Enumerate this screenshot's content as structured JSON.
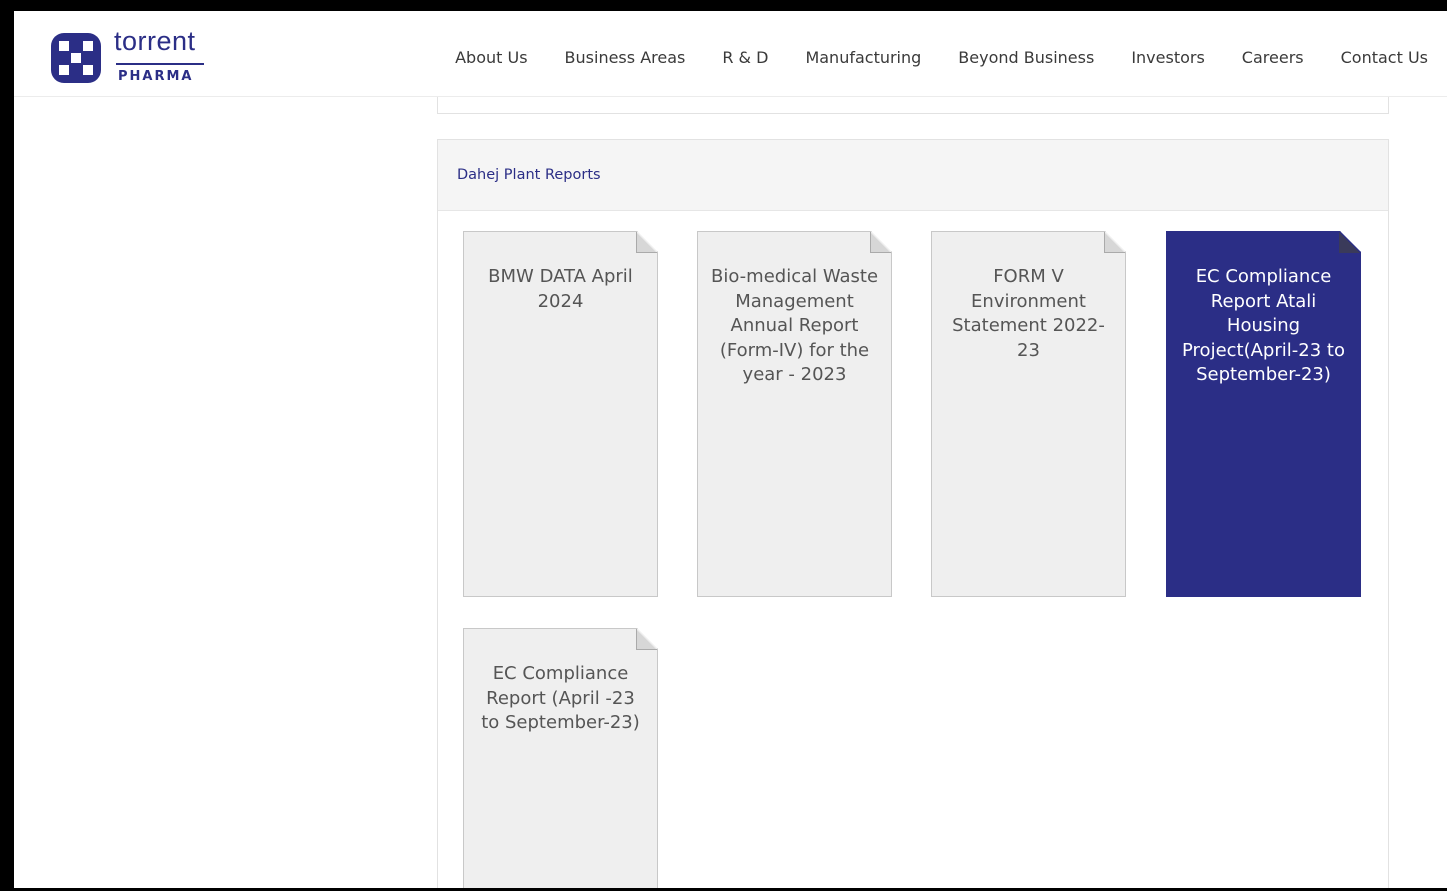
{
  "logo": {
    "wordmark": "torrent",
    "sub": "PHARMA",
    "icon": "torrent-logo-icon",
    "brand_color": "#2b2e86"
  },
  "nav": {
    "items": [
      {
        "label": "About Us"
      },
      {
        "label": "Business Areas"
      },
      {
        "label": "R & D"
      },
      {
        "label": "Manufacturing"
      },
      {
        "label": "Beyond Business"
      },
      {
        "label": "Investors"
      },
      {
        "label": "Careers"
      },
      {
        "label": "Contact Us"
      }
    ]
  },
  "section": {
    "title": "Dahej Plant Reports",
    "reports": [
      {
        "label": "BMW DATA April 2024",
        "active": false
      },
      {
        "label": "Bio-medical Waste Management Annual Report (Form-IV) for the year - 2023",
        "active": false
      },
      {
        "label": "FORM V Environment Statement 2022-23",
        "active": false
      },
      {
        "label": "EC Compliance Report Atali Housing Project(April-23 to September-23)",
        "active": true
      },
      {
        "label": "EC Compliance Report (April -23 to September-23)",
        "active": false
      }
    ]
  },
  "colors": {
    "accent": "#2b2e86",
    "card_bg": "#efefef",
    "header_bg": "#f5f5f5"
  }
}
